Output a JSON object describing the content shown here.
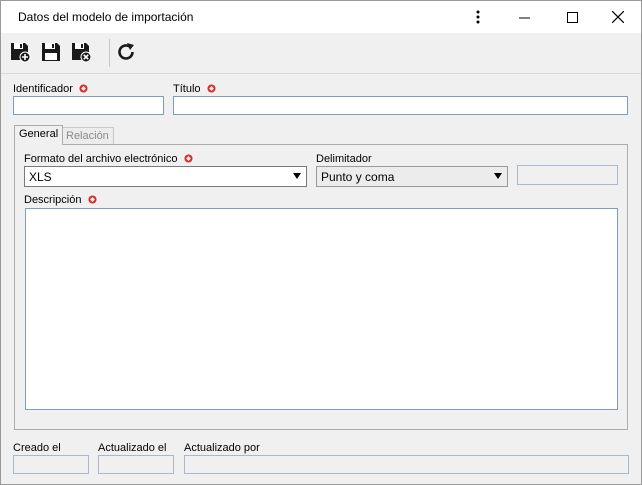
{
  "window": {
    "title": "Datos del modelo de importación"
  },
  "toolbar": {
    "icons": [
      "save-new-icon",
      "save-icon",
      "save-close-icon",
      "refresh-icon"
    ]
  },
  "form": {
    "identificador_label": "Identificador",
    "identificador_value": "",
    "titulo_label": "Título",
    "titulo_value": ""
  },
  "tabs": [
    {
      "label": "General",
      "active": true
    },
    {
      "label": "Relación",
      "active": false
    }
  ],
  "general": {
    "formato_label": "Formato del archivo electrónico",
    "formato_value": "XLS",
    "delimitador_label": "Delimitador",
    "delimitador_value": "Punto y coma",
    "extra_value": "",
    "descripcion_label": "Descripción",
    "descripcion_value": ""
  },
  "footer": {
    "creado_label": "Creado el",
    "actualizado_el_label": "Actualizado el",
    "actualizado_por_label": "Actualizado por"
  },
  "colors": {
    "required": "#d32f2f",
    "input_border": "#7a9cc6"
  }
}
